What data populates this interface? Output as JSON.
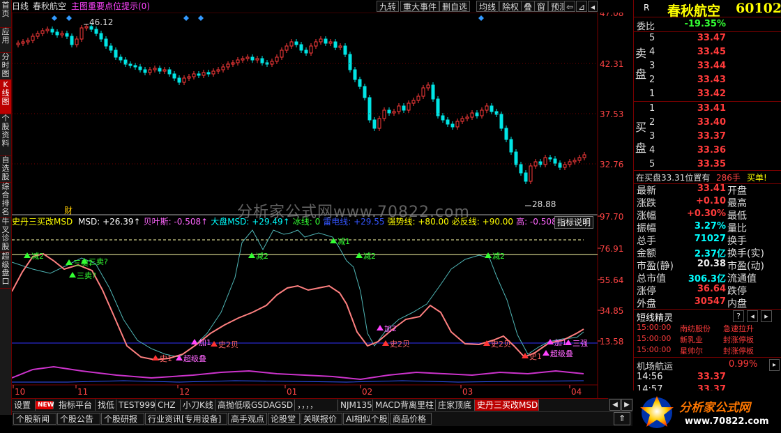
{
  "left_tabs": [
    {
      "label": "首页",
      "active": false
    },
    {
      "label": "应用",
      "active": false
    },
    {
      "label": "分时图",
      "active": false
    },
    {
      "label": "K线图",
      "active": true
    },
    {
      "label": "个股资料",
      "active": false
    },
    {
      "label": "自选股",
      "active": false
    },
    {
      "label": "综合排名",
      "active": false
    },
    {
      "label": "牛叉诊股",
      "active": false
    },
    {
      "label": "超级盘口",
      "active": false
    }
  ],
  "toolbar": {
    "period": "日线",
    "stock": "春秋航空",
    "hint": "主图重要点位提示(0)",
    "buttons": [
      "九转",
      "重大事件",
      "删自选",
      "均线",
      "除权",
      "叠",
      "窗",
      "预测"
    ]
  },
  "main_chart": {
    "price_axis": [
      "47.08",
      "42.31",
      "37.53",
      "32.76"
    ],
    "high_label": "46.12",
    "low_label": "28.88",
    "marker": "财",
    "watermark": "分析家公式网www.70822.com"
  },
  "indicator": {
    "name": "史丹三买改MSD",
    "fields": [
      {
        "text": "MSD: +26.39↑",
        "color": "#ffffff"
      },
      {
        "text": "贝叶斯: -0.508↑",
        "color": "#ff66ff"
      },
      {
        "text": "大盘MSD: +29.49↑",
        "color": "#00ffff"
      },
      {
        "text": "冰线: 0",
        "color": "#33ff33"
      },
      {
        "text": "雷电线: +29.55",
        "color": "#3355ff"
      },
      {
        "text": "强势线: +80.00",
        "color": "#ffff00"
      },
      {
        "text": "必反线: +90.00",
        "color": "#ffff00"
      },
      {
        "text": "高: -0.508↑",
        "color": "#ff66ff"
      }
    ],
    "button": "指标说明",
    "axis": [
      "97.70",
      "76.91",
      "55.64",
      "34.85",
      "13.58"
    ],
    "signals": [
      {
        "text": "减2",
        "kind": "reduce"
      },
      {
        "text": "三卖?",
        "kind": "sell"
      },
      {
        "text": "三卖?",
        "kind": "sell"
      },
      {
        "text": "三卖?",
        "kind": "sell"
      },
      {
        "text": "减2",
        "kind": "reduce"
      },
      {
        "text": "减1",
        "kind": "reduce"
      },
      {
        "text": "减2",
        "kind": "reduce"
      },
      {
        "text": "减2",
        "kind": "reduce"
      },
      {
        "text": "史1",
        "kind": "buy"
      },
      {
        "text": "超级叠",
        "kind": "buy2"
      },
      {
        "text": "加1",
        "kind": "add"
      },
      {
        "text": "史2贝",
        "kind": "buy"
      },
      {
        "text": "加2",
        "kind": "add"
      },
      {
        "text": "史2贝",
        "kind": "buy"
      },
      {
        "text": "史2贝",
        "kind": "buy"
      },
      {
        "text": "史1",
        "kind": "buy"
      },
      {
        "text": "超级叠",
        "kind": "buy2"
      },
      {
        "text": "加1",
        "kind": "add"
      },
      {
        "text": "三强",
        "kind": "add"
      }
    ]
  },
  "time_axis": [
    "10",
    "11",
    "12",
    "01",
    "02",
    "03",
    "04"
  ],
  "bottom_tabs": [
    {
      "label": "设置"
    },
    {
      "label": "NEW",
      "badge": true
    },
    {
      "label": "指标平台"
    },
    {
      "label": "找低"
    },
    {
      "label": "TEST999"
    },
    {
      "label": "CHZ"
    },
    {
      "label": "小刀K线"
    },
    {
      "label": "高抛低吸GSDAGSD"
    },
    {
      "label": "，，，，"
    },
    {
      "label": "NJM135"
    },
    {
      "label": "MACD背离里柱"
    },
    {
      "label": "庄家顶底"
    },
    {
      "label": "史丹三买改MSD",
      "active": true
    }
  ],
  "news_tabs": [
    "个股新闻",
    "个股公告",
    "个股研报",
    "行业资讯[专用设备]",
    "高手观点",
    "论股堂",
    "关联报价",
    "AI相似个股",
    "商品价格"
  ],
  "quote": {
    "r_badge": "R",
    "name": "春秋航空",
    "code": "60102",
    "weibi_label": "委比",
    "weibi": "-19.35%",
    "sell_label": "卖盘",
    "buy_label": "买盘",
    "sell": [
      {
        "n": "5",
        "p": "33.47"
      },
      {
        "n": "4",
        "p": "33.45"
      },
      {
        "n": "3",
        "p": "33.44"
      },
      {
        "n": "2",
        "p": "33.43"
      },
      {
        "n": "1",
        "p": "33.42"
      }
    ],
    "buy": [
      {
        "n": "1",
        "p": "33.41"
      },
      {
        "n": "2",
        "p": "33.40"
      },
      {
        "n": "3",
        "p": "33.37"
      },
      {
        "n": "4",
        "p": "33.36"
      },
      {
        "n": "5",
        "p": "33.35"
      }
    ],
    "inbuy_text": "在买盘33.31位置有",
    "inbuy_qty": "286手",
    "inbuy_tag": "买单!",
    "stats": [
      {
        "l": "最新",
        "v": "33.41",
        "vc": "red",
        "r": "开盘"
      },
      {
        "l": "涨跌",
        "v": "+0.10",
        "vc": "red",
        "r": "最高"
      },
      {
        "l": "涨幅",
        "v": "+0.30%",
        "vc": "red",
        "r": "最低"
      },
      {
        "l": "振幅",
        "v": "3.27%",
        "vc": "cyan",
        "r": "量比"
      },
      {
        "l": "总手",
        "v": "71027",
        "vc": "cyan",
        "r": "换手"
      },
      {
        "l": "金额",
        "v": "2.37亿",
        "vc": "cyan",
        "r": "换手(实)"
      },
      {
        "l": "市盈(静)",
        "v": "20.38",
        "vc": "white",
        "r": "市盈(动)"
      },
      {
        "l": "总市值",
        "v": "306.3亿",
        "vc": "cyan",
        "r": "流通值"
      },
      {
        "l": "涨停",
        "v": "36.64",
        "vc": "red",
        "r": "跌停"
      },
      {
        "l": "外盘",
        "v": "30547",
        "vc": "red",
        "r": "内盘"
      }
    ],
    "shortline_title": "短线精灵",
    "shortline": [
      {
        "t": "15:00:00",
        "s": "南纺股份",
        "e": "急速拉升"
      },
      {
        "t": "15:00:00",
        "s": "新乳业",
        "e": "封涨停板"
      },
      {
        "t": "15:00:00",
        "s": "星帅尔",
        "e": "封涨停板"
      }
    ],
    "sector_name": "机场航运",
    "sector_pct": "0.99%",
    "ticks": [
      {
        "t": "14:56",
        "p": "33.37"
      },
      {
        "t": "14:57",
        "p": "33.37"
      }
    ]
  },
  "logo": {
    "text": "分析家公式网",
    "url": "www.70822.com"
  },
  "colors": {
    "up": "#ff3b3b",
    "down": "#00e5e5",
    "grid": "#7a0000",
    "msd": "#ff8080",
    "market": "#4fb6b6"
  }
}
